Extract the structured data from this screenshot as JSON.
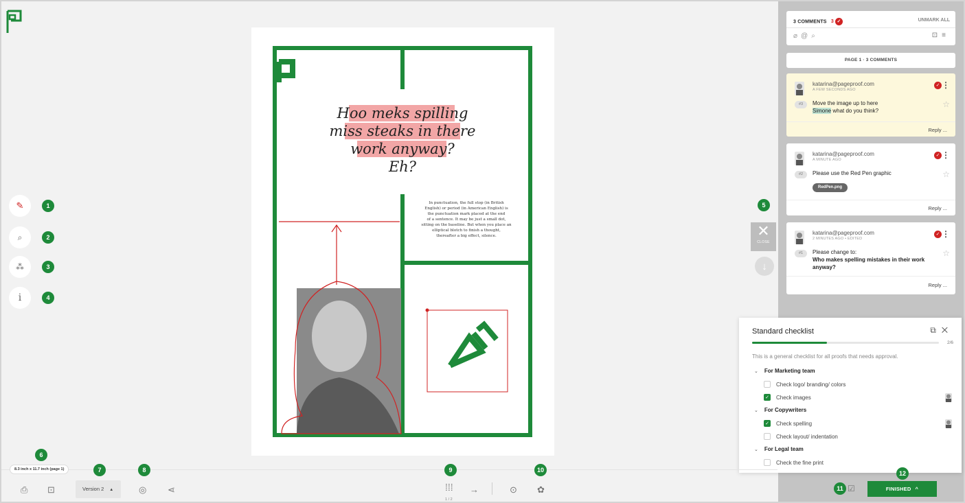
{
  "colors": {
    "accent": "#1e8a3a",
    "resolved_red": "#d02323",
    "highlight_bg": "#fdf8dc"
  },
  "proof": {
    "headline": [
      "Hoo meks spilling",
      "miss steaks in there",
      "work anyway?"
    ],
    "headline_tail": "Eh?",
    "body": [
      "In punctuation, the full stop (in British",
      "English) or period (in American English) is",
      "the punctuation mark placed at the end",
      "of a sentence. It may be just a small dot,",
      "sitting on the baseline. But when you place an",
      "elliptical blotch to finish a thought,",
      "thereafter a big effect, silence."
    ]
  },
  "left_tools": [
    {
      "name": "markup-pen-tool",
      "icon": "pen-icon",
      "badge": "1"
    },
    {
      "name": "zoom-tool",
      "icon": "zoom-icon",
      "badge": "2"
    },
    {
      "name": "magic-tool",
      "icon": "magic-wand-icon",
      "badge": "3"
    },
    {
      "name": "info-tool",
      "icon": "info-icon",
      "glyph": "i",
      "badge": "4"
    }
  ],
  "callouts": {
    "b5": "5",
    "b6": "6",
    "b7": "7",
    "b8": "8",
    "b9": "9",
    "b10": "10",
    "b11": "11",
    "b12": "12"
  },
  "close_label": "CLOSE",
  "comments_panel": {
    "count_label": "3 COMMENTS",
    "resolved_count": "3",
    "unmark_all": "UNMARK ALL",
    "page_header": "PAGE 1 · 3 COMMENTS",
    "comments": [
      {
        "author": "katarina@pageproof.com",
        "time": "A FEW SECONDS AGO",
        "number": "#3",
        "line1": "Move the image up to here",
        "mention": "Simone",
        "line2_rest": " what do you think?",
        "reply": "Reply ..."
      },
      {
        "author": "katarina@pageproof.com",
        "time": "A MINUTE AGO",
        "number": "#2",
        "text": "Please use the Red Pen graphic",
        "attachment": "RedPen.png",
        "reply": "Reply ..."
      },
      {
        "author": "katarina@pageproof.com",
        "time": "2 MINUTES AGO  •  EDITED",
        "number": "#1",
        "line1": "Please change to:",
        "bold": "Who makes spelling mistakes in their work anyway?",
        "reply": "Reply ..."
      }
    ]
  },
  "checklist": {
    "title": "Standard checklist",
    "progress": 0.4,
    "fraction": "2/6",
    "description": "This is a general checklist for all proofs that needs approval.",
    "sections": [
      {
        "title": "For Marketing team",
        "items": [
          {
            "label": "Check logo/ branding/ colors",
            "checked": false
          },
          {
            "label": "Check images",
            "checked": true
          }
        ]
      },
      {
        "title": "For Copywriters",
        "items": [
          {
            "label": "Check spelling",
            "checked": true
          },
          {
            "label": "Check layout/ indentation",
            "checked": false
          }
        ]
      },
      {
        "title": "For Legal team",
        "items": [
          {
            "label": "Check the fine print",
            "checked": false
          }
        ]
      }
    ]
  },
  "bottom": {
    "dimensions": "8.3 inch x 11.7 inch (page 1)",
    "version": "Version 2",
    "page_indicator": "1 / 2",
    "finished": "FINISHED"
  }
}
